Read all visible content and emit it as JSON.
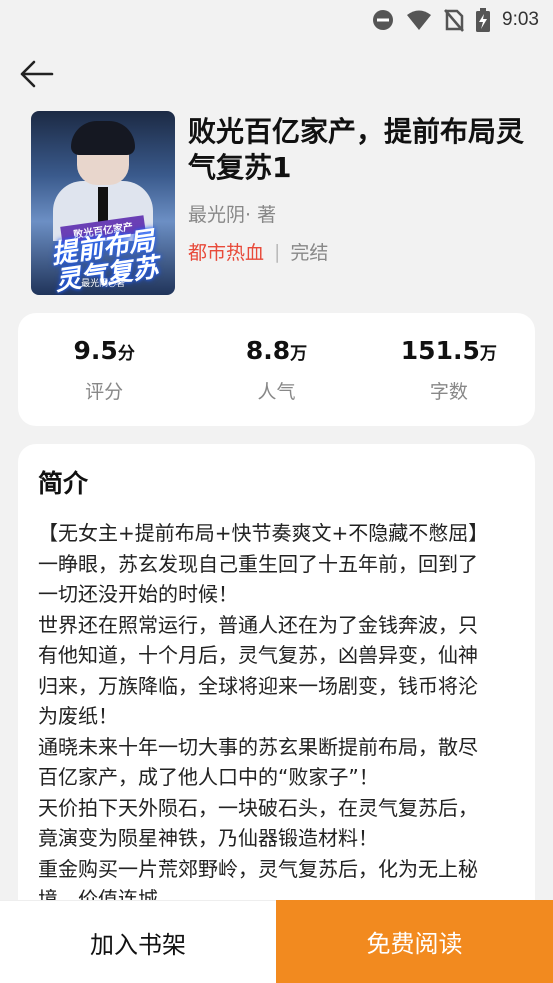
{
  "status_bar": {
    "time": "9:03",
    "icons": [
      "do-not-disturb-icon",
      "wifi-icon",
      "no-sim-icon",
      "battery-charging-icon"
    ]
  },
  "nav": {
    "back_icon": "arrow-left-icon"
  },
  "book": {
    "cover": {
      "small_text": "败光百亿家产",
      "big_text_line1": "提前布局",
      "big_text_line2": "灵气复苏",
      "author_text": "最光阴○著"
    },
    "title": "败光百亿家产，提前布局灵气复苏1",
    "author": "最光阴· 著",
    "genre": "都市热血",
    "separator": "|",
    "status": "完结"
  },
  "stats": [
    {
      "value": "9.5",
      "unit": "分",
      "label": "评分"
    },
    {
      "value": "8.8",
      "unit": "万",
      "label": "人气"
    },
    {
      "value": "151.5",
      "unit": "万",
      "label": "字数"
    }
  ],
  "intro": {
    "heading": "简介",
    "lines": [
      "【无女主+提前布局+快节奏爽文+不隐藏不憋屈】",
      "一睁眼，苏玄发现自己重生回了十五年前，回到了",
      "一切还没开始的时候！",
      "世界还在照常运行，普通人还在为了金钱奔波，只",
      "有他知道，十个月后，灵气复苏，凶兽异变，仙神",
      "归来，万族降临，全球将迎来一场剧变，钱币将沦",
      "为废纸！",
      "通晓未来十年一切大事的苏玄果断提前布局，散尽",
      "百亿家产，成了他人口中的“败家子”！",
      "天价拍下天外陨石，一块破石头，在灵气复苏后，",
      "竟演变为陨星神铁，乃仙器锻造材料！",
      "重金购买一片荒郊野岭，灵气复苏后，化为无上秘",
      "境，价值连城……"
    ]
  },
  "bottom": {
    "add_shelf_label": "加入书架",
    "read_label": "免费阅读",
    "accent_color": "#f28a1f"
  }
}
